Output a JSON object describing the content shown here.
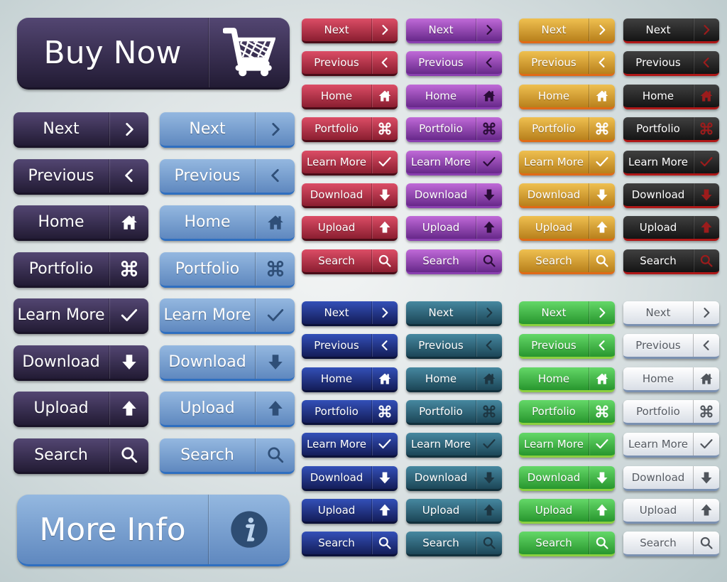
{
  "labels": [
    "Next",
    "Previous",
    "Home",
    "Portfolio",
    "Learn More",
    "Download",
    "Upload",
    "Search"
  ],
  "icons": [
    "chevron-right",
    "chevron-left",
    "home",
    "command",
    "check",
    "arrow-down",
    "arrow-up",
    "search"
  ],
  "buy_now": {
    "label": "Buy Now",
    "icon": "shopping-cart"
  },
  "more_info": {
    "label": "More Info",
    "icon": "info"
  },
  "themes": {
    "dark-purple": {
      "top": "#534672",
      "bottom": "#221b34",
      "text": "#ffffff",
      "icon": "#ffffff",
      "edge": "#1a1428"
    },
    "light-blue": {
      "top": "#94b8e0",
      "bottom": "#5f88bf",
      "text": "#ffffff",
      "icon": "#2f4f78",
      "edge": "#2f6fc0"
    },
    "red": {
      "top": "#dc4d66",
      "bottom": "#8a1e30",
      "text": "#ffffff",
      "icon": "#ffffff",
      "edge": "#4a0d18"
    },
    "purple": {
      "top": "#c06ad8",
      "bottom": "#67288a",
      "text": "#ffffff",
      "icon": "#2a0c38",
      "edge": "#8a40b0"
    },
    "gold": {
      "top": "#efc050",
      "bottom": "#b8801c",
      "text": "#ffffff",
      "icon": "#ffffff",
      "edge": "#e06a18"
    },
    "black": {
      "top": "#404040",
      "bottom": "#141414",
      "text": "#ffffff",
      "icon": "#9c1c1c",
      "edge": "#b01818"
    },
    "navy": {
      "top": "#3350b8",
      "bottom": "#141d58",
      "text": "#ffffff",
      "icon": "#ffffff",
      "edge": "#0c123a"
    },
    "teal": {
      "top": "#4688a0",
      "bottom": "#1c4657",
      "text": "#ffffff",
      "icon": "#1d3642",
      "edge": "#12303c"
    },
    "green": {
      "top": "#64d868",
      "bottom": "#28962e",
      "text": "#ffffff",
      "icon": "#ffffff",
      "edge": "#8cd040"
    },
    "white": {
      "top": "#ffffff",
      "bottom": "#d9dee6",
      "text": "#555a62",
      "icon": "#50555c",
      "edge": "#7a90b0"
    }
  },
  "medium_columns": [
    "dark-purple",
    "light-blue"
  ],
  "small_top_columns": [
    "red",
    "purple",
    "gold",
    "black"
  ],
  "small_bottom_columns": [
    "navy",
    "teal",
    "green",
    "white"
  ]
}
